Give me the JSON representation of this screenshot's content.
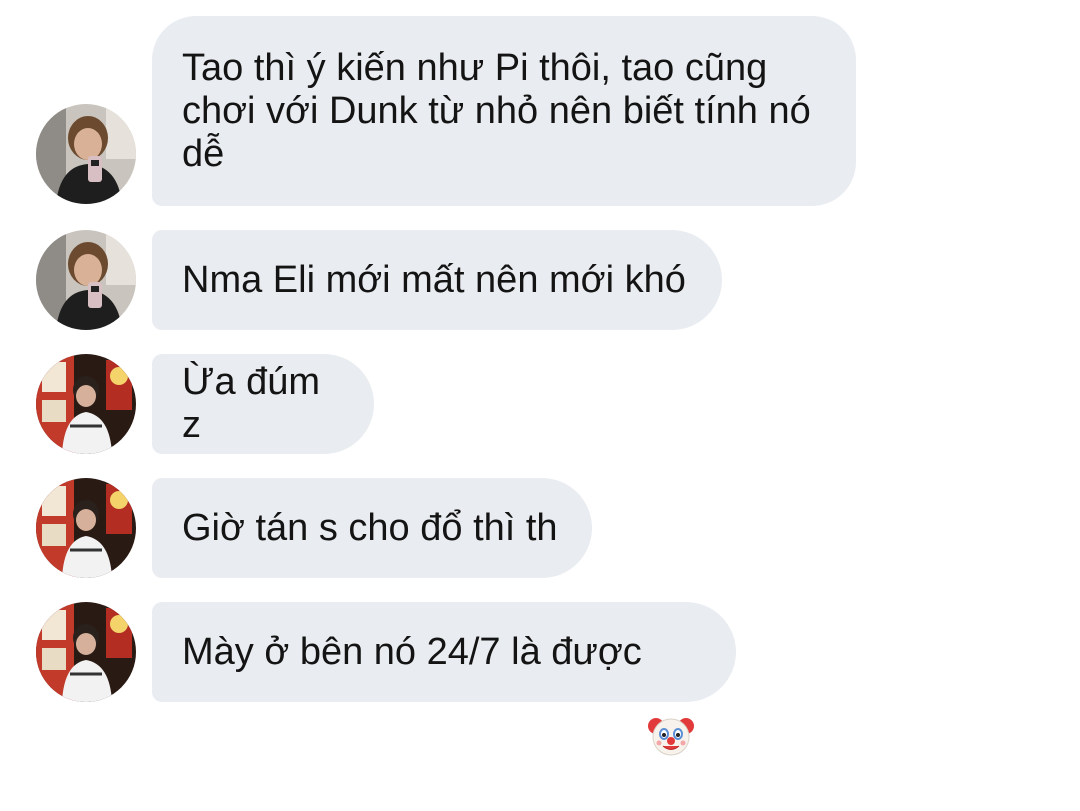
{
  "messages": [
    {
      "sender": "user-a",
      "text": "Tao thì ý kiến như Pi thôi, tao cũng\nchơi với Dunk từ nhỏ nên biết tính nó\ndễ"
    },
    {
      "sender": "user-a",
      "text": "Nma Eli mới mất nên mới khó"
    },
    {
      "sender": "user-b",
      "text": "Ừa đúm z"
    },
    {
      "sender": "user-b",
      "text": "Giờ tán s cho đổ thì th"
    },
    {
      "sender": "user-b",
      "text": "Mày ở bên nó 24/7 là được",
      "emoji": "clown-face-icon"
    }
  ],
  "colors": {
    "bubble": "#e9ecf0",
    "text": "#141414",
    "background": "#ffffff"
  }
}
